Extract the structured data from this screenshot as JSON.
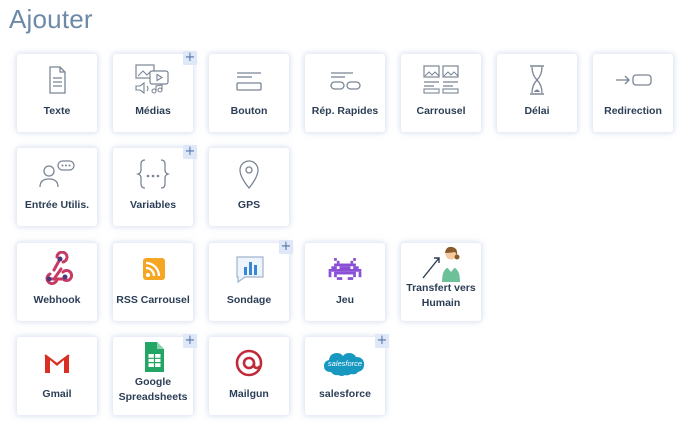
{
  "header": {
    "title": "Ajouter"
  },
  "rows": [
    [
      {
        "label": "Texte",
        "icon": "text-icon",
        "plus": false
      },
      {
        "label": "Médias",
        "icon": "media-icon",
        "plus": true
      },
      {
        "label": "Bouton",
        "icon": "button-icon",
        "plus": false
      },
      {
        "label": "Rép. Rapides",
        "icon": "quick-replies-icon",
        "plus": false
      },
      {
        "label": "Carrousel",
        "icon": "carousel-icon",
        "plus": false
      },
      {
        "label": "Délai",
        "icon": "hourglass-icon",
        "plus": false
      },
      {
        "label": "Redirection",
        "icon": "redirect-icon",
        "plus": false
      }
    ],
    [
      {
        "label": "Entrée Utilis.",
        "icon": "user-input-icon",
        "plus": false
      },
      {
        "label": "Variables",
        "icon": "variables-icon",
        "plus": true
      },
      {
        "label": "GPS",
        "icon": "location-pin-icon",
        "plus": false
      }
    ],
    [
      {
        "label": "Webhook",
        "icon": "webhook-icon",
        "plus": false
      },
      {
        "label": "RSS Carrousel",
        "icon": "rss-icon",
        "plus": false
      },
      {
        "label": "Sondage",
        "icon": "poll-icon",
        "plus": true
      },
      {
        "label": "Jeu",
        "icon": "space-invader-icon",
        "plus": false
      },
      {
        "label": "Transfert vers Humain",
        "icon": "human-agent-icon",
        "plus": false
      }
    ],
    [
      {
        "label": "Gmail",
        "icon": "gmail-icon",
        "plus": false
      },
      {
        "label": "Google Spreadsheets",
        "icon": "google-sheets-icon",
        "plus": true
      },
      {
        "label": "Mailgun",
        "icon": "mailgun-icon",
        "plus": false
      },
      {
        "label": "salesforce",
        "icon": "salesforce-icon",
        "plus": true,
        "logo_text": "salesforce"
      }
    ]
  ],
  "plus_symbol": "+",
  "colors": {
    "title": "#6c8aa8",
    "label": "#2c3e56",
    "icon_stroke": "#7a8594",
    "webhook": "#c73a63",
    "rss": "#f5a623",
    "poll": "#3a86d6",
    "game": "#8a4fd6",
    "gmail": "#d93025",
    "sheets": "#23a566",
    "mailgun": "#c02b39",
    "salesforce": "#1798c1"
  }
}
